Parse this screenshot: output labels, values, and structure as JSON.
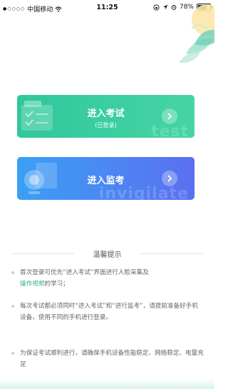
{
  "status_bar": {
    "carrier": "中国移动",
    "time": "11:25",
    "battery": "78%",
    "battery_level": 0.78
  },
  "cards": {
    "exam": {
      "title": "进入考试",
      "subtitle": "(已登录)",
      "watermark": "test",
      "icon": "chevron-right-icon"
    },
    "monitor": {
      "title": "进入监考",
      "watermark": "invigilate",
      "icon": "chevron-right-icon"
    }
  },
  "tips": {
    "heading": "温馨提示",
    "items": [
      {
        "text_before": "首次登录可优先“进入考试”界面进行人脸采集及",
        "link": "操作视频",
        "text_after": "的学习；"
      },
      {
        "text": "每次考试都必须同时“进入考试”和“进行监考”，请提前准备好手机设备，使用不同的手机进行登录。"
      },
      {
        "text": "为保证考试顺利进行，请确保手机设备性能稳定、网络稳定、电量充足"
      }
    ]
  },
  "colors": {
    "exam_card": "#2fc79b",
    "monitor_card": "#4a8af2",
    "link": "#2db38a"
  }
}
